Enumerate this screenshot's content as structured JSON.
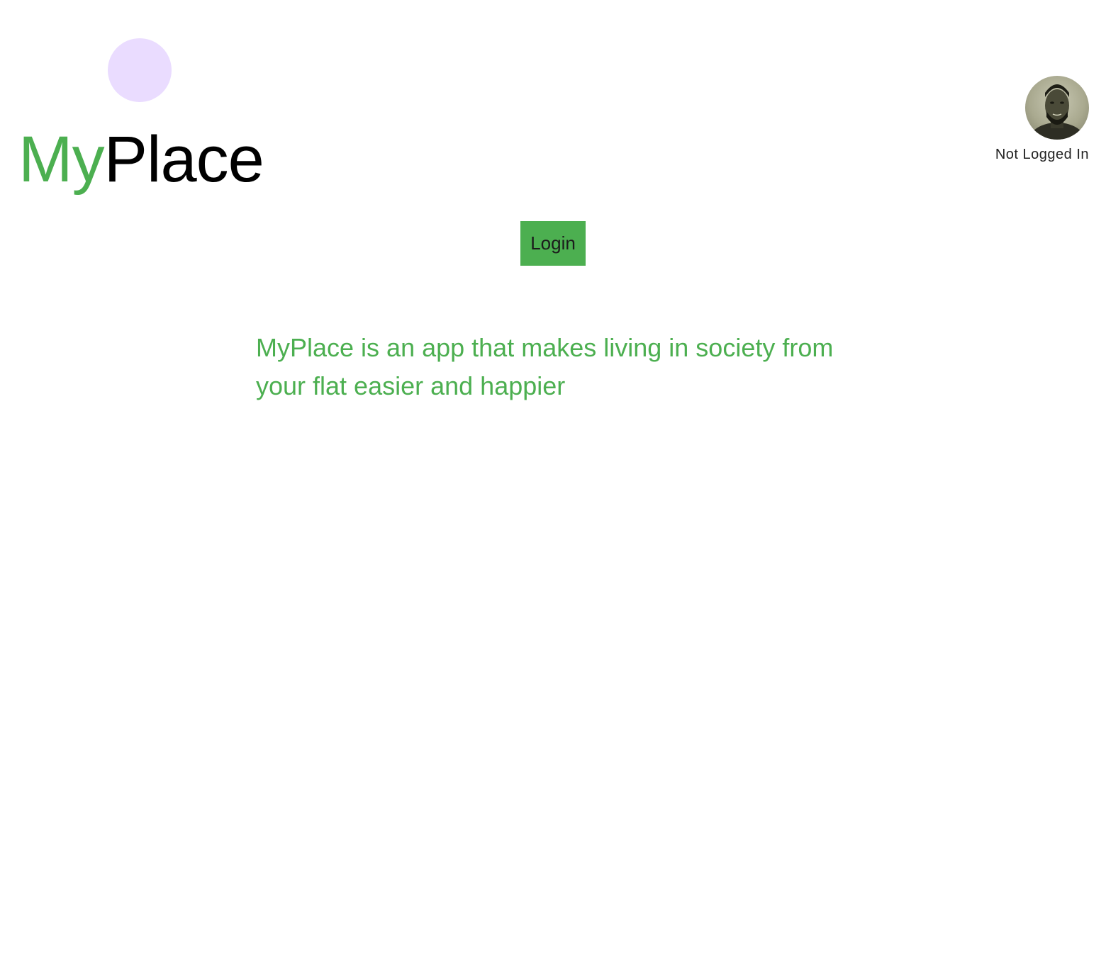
{
  "header": {
    "logo": {
      "part1": "My",
      "part2": "Place"
    }
  },
  "profile": {
    "status": "Not Logged In",
    "avatar_icon": "user-avatar-photo"
  },
  "main": {
    "login_label": "Login",
    "tagline": "MyPlace is an app that makes living in society from your flat easier and happier"
  },
  "colors": {
    "brand_green": "#4caf50",
    "decor_lavender": "#eadcff",
    "logo_dark": "#000000"
  }
}
